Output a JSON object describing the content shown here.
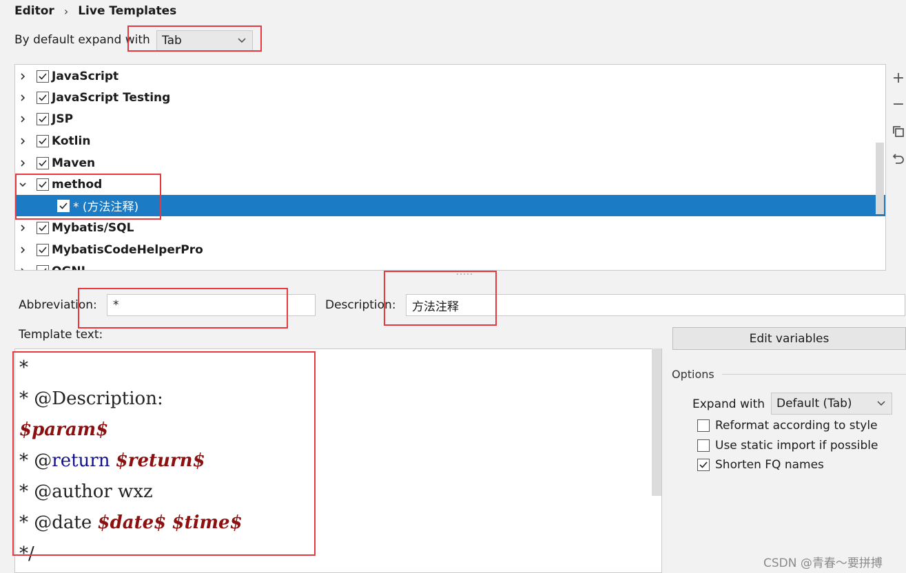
{
  "breadcrumb": {
    "parent": "Editor",
    "separator": "›",
    "current": "Live Templates"
  },
  "expand_default": {
    "label": "By default expand with",
    "value": "Tab"
  },
  "tree": {
    "items": [
      {
        "label": "JavaScript",
        "checked": true,
        "expanded": false
      },
      {
        "label": "JavaScript Testing",
        "checked": true,
        "expanded": false
      },
      {
        "label": "JSP",
        "checked": true,
        "expanded": false
      },
      {
        "label": "Kotlin",
        "checked": true,
        "expanded": false
      },
      {
        "label": "Maven",
        "checked": true,
        "expanded": false
      },
      {
        "label": "method",
        "checked": true,
        "expanded": true
      },
      {
        "label": "* (方法注释)",
        "checked": true,
        "child": true,
        "selected": true
      },
      {
        "label": "Mybatis/SQL",
        "checked": true,
        "expanded": false
      },
      {
        "label": "MybatisCodeHelperPro",
        "checked": true,
        "expanded": false
      },
      {
        "label": "OGNL",
        "checked": true,
        "expanded": false
      }
    ]
  },
  "toolbar": {
    "add": "+",
    "remove": "−",
    "copy": "copy-icon",
    "revert": "revert-icon"
  },
  "abbreviation": {
    "label": "Abbreviation:",
    "value": "*"
  },
  "description": {
    "label": "Description:",
    "value": "方法注释"
  },
  "template": {
    "label": "Template text:",
    "lines": {
      "l1": "*",
      "l2": "* @Description:",
      "l3_var": "$param$",
      "l4_prefix": "* @",
      "l4_kw": "return",
      "l4_var": "$return$",
      "l5": "* @author wxz",
      "l6_prefix": "* @date ",
      "l6_var1": "$date$",
      "l6_var2": "$time$",
      "l7": "*/"
    }
  },
  "edit_variables_label": "Edit variables",
  "options": {
    "title": "Options",
    "expand_with_label": "Expand with",
    "expand_with_value": "Default (Tab)",
    "reformat": {
      "label": "Reformat according to style",
      "checked": false
    },
    "static_import": {
      "label": "Use static import if possible",
      "checked": false
    },
    "shorten": {
      "label": "Shorten FQ names",
      "checked": true
    }
  },
  "watermark": "CSDN @青春～要拼搏",
  "colors": {
    "selection": "#1b7bc4",
    "highlight": "#e8373d",
    "keyword": "#10108c",
    "variable": "#8c1010"
  }
}
